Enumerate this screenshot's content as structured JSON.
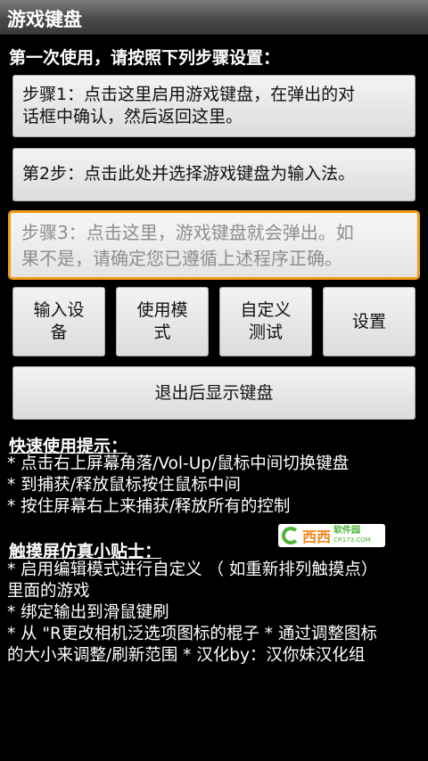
{
  "app": {
    "title": "游戏键盘"
  },
  "setup": {
    "heading": "第一次使用，请按照下列步骤设置：",
    "step1": [
      "步骤1：点击这里启用游戏键盘，在弹出的对",
      "话框中确认，然后返回这里。"
    ],
    "step2": "第2步：点击此处并选择游戏键盘为输入法。",
    "step3": [
      "步骤3：点击这里，游戏键盘就会弹出。如",
      "果不是，请确定您已遵循上述程序正确。"
    ]
  },
  "buttons": {
    "input_device": [
      "输入设",
      "备"
    ],
    "use_mode": [
      "使用模",
      "式"
    ],
    "custom_test": [
      "自定义",
      "测试"
    ],
    "settings": "设置",
    "exit_show": "退出后显示键盘"
  },
  "quick_tips": {
    "title": "快速使用提示：",
    "lines": [
      "* 点击右上屏幕角落/Vol-Up/鼠标中间切换键盘",
      "* 到捕获/释放鼠标按住鼠标中间",
      "* 按住屏幕右上来捕获/释放所有的控制"
    ]
  },
  "touch_tips": {
    "title": "触摸屏仿真小贴士：",
    "lines": [
      "* 启用编辑模式进行自定义 （ 如重新排列触摸点）",
      "里面的游戏",
      "* 绑定输出到滑鼠键刷",
      "* 从 \"R更改相机泛选项图标的棍子 * 通过调整图标",
      "的大小来调整/刷新范围 * 汉化by：汉你妹汉化组"
    ]
  },
  "watermark": {
    "main": "西西",
    "sub": "软件园",
    "url": "CR173.COM"
  },
  "colors": {
    "focus_border": "#f29a1d",
    "background": "#000000",
    "button_face": "#e6e6e6"
  }
}
